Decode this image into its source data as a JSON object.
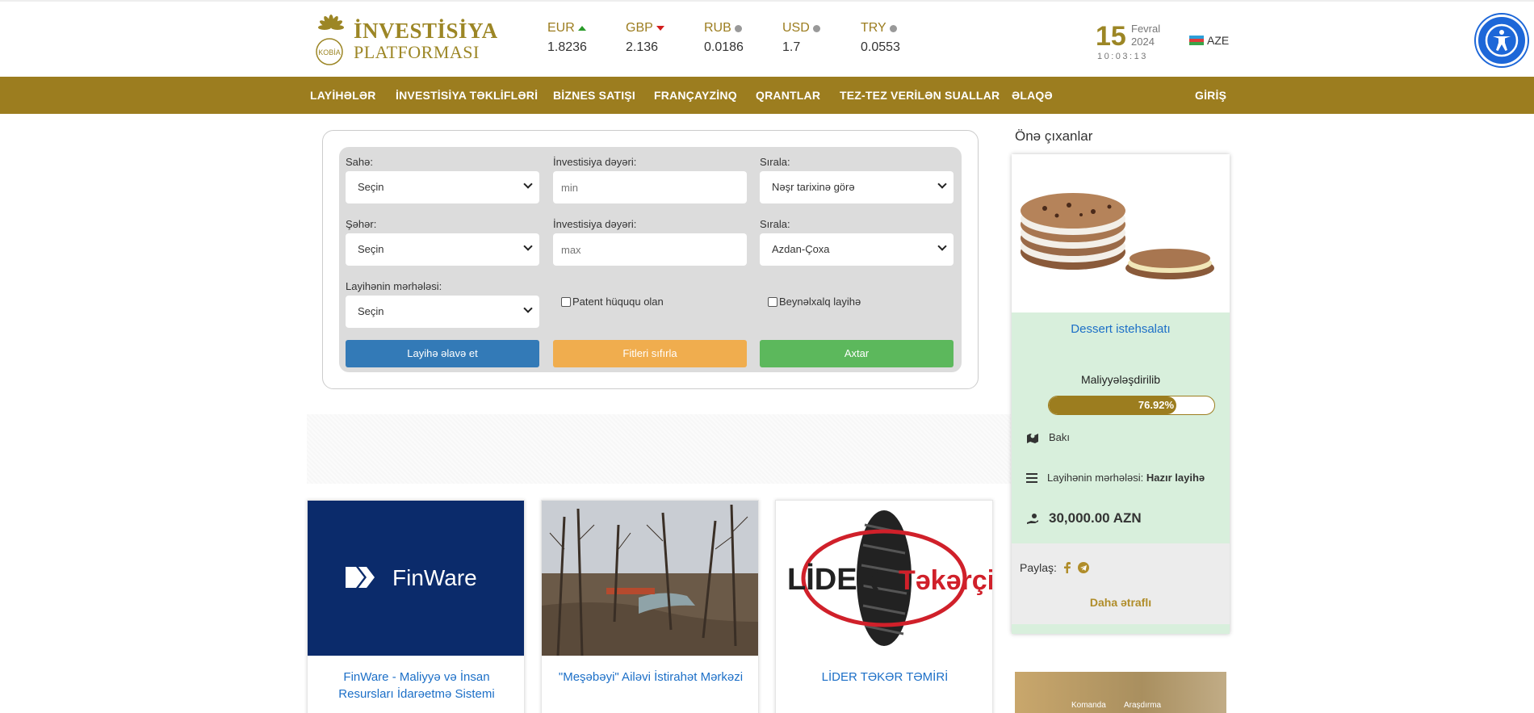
{
  "logo": {
    "line1": "İNVESTİSİYA",
    "line2": "PLATFORMASI",
    "badge": "KOBİA"
  },
  "rates": [
    {
      "code": "EUR",
      "value": "1.8236",
      "trend": "up"
    },
    {
      "code": "GBP",
      "value": "2.136",
      "trend": "down"
    },
    {
      "code": "RUB",
      "value": "0.0186",
      "trend": "flat"
    },
    {
      "code": "USD",
      "value": "1.7",
      "trend": "flat"
    },
    {
      "code": "TRY",
      "value": "0.0553",
      "trend": "flat"
    }
  ],
  "date": {
    "day": "15",
    "month": "Fevral",
    "year": "2024",
    "time": "10:03:13"
  },
  "language": "AZE",
  "colors": {
    "gold": "#9c7d1f",
    "blue_btn": "#337ab7",
    "orange_btn": "#f0ad4e",
    "green_btn": "#5cb85c",
    "link": "#1c6fc7"
  },
  "nav": {
    "items": [
      "LAYİHƏLƏR",
      "İNVESTİSİYA TƏKLİFLƏRİ",
      "BİZNES SATIŞI",
      "FRANÇAYZİNQ",
      "QRANTLAR",
      "TEZ-TEZ VERİLƏN SUALLAR",
      "ƏLAQƏ"
    ],
    "login": "GİRİŞ"
  },
  "filters": {
    "sector_label": "Sahə:",
    "sector_value": "Seçin",
    "invest_min_label": "İnvestisiya dəyəri:",
    "invest_min_placeholder": "min",
    "sort1_label": "Sırala:",
    "sort1_value": "Nəşr tarixinə görə",
    "city_label": "Şəhər:",
    "city_value": "Seçin",
    "invest_max_label": "İnvestisiya dəyəri:",
    "invest_max_placeholder": "max",
    "sort2_label": "Sırala:",
    "sort2_value": "Azdan-Çoxa",
    "stage_label": "Layihənin mərhələsi:",
    "stage_value": "Seçin",
    "patent_label": "Patent hüququ olan",
    "international_label": "Beynəlxalq layihə",
    "add_button": "Layihə əlavə et",
    "reset_button": "Fitleri sıfırla",
    "search_button": "Axtar"
  },
  "cards": [
    {
      "title": "FinWare - Maliyyə və İnsan Resursları İdarəetmə Sistemi",
      "logo_text": "FinWare"
    },
    {
      "title": "\"Meşəbəyi\" Ailəvi İstirahət Mərkəzi"
    },
    {
      "title": "LİDER TƏKƏR TƏMİRİ",
      "logo_left": "LİDER",
      "logo_right": "Təkərçi"
    }
  ],
  "featured": {
    "heading": "Önə çıxanlar",
    "title": "Dessert istehsalatı",
    "status": "Maliyyələşdirilib",
    "progress_percent": 76.92,
    "progress_label": "76.92%",
    "city": "Bakı",
    "stage_label": "Layihənin mərhələsi:",
    "stage_value": "Hazır layihə",
    "price": "30,000.00 AZN",
    "share_label": "Paylaş:",
    "more_label": "Daha ətraflı"
  },
  "featured2": {
    "caption_left": "Komanda",
    "caption_right": "Araşdırma"
  }
}
